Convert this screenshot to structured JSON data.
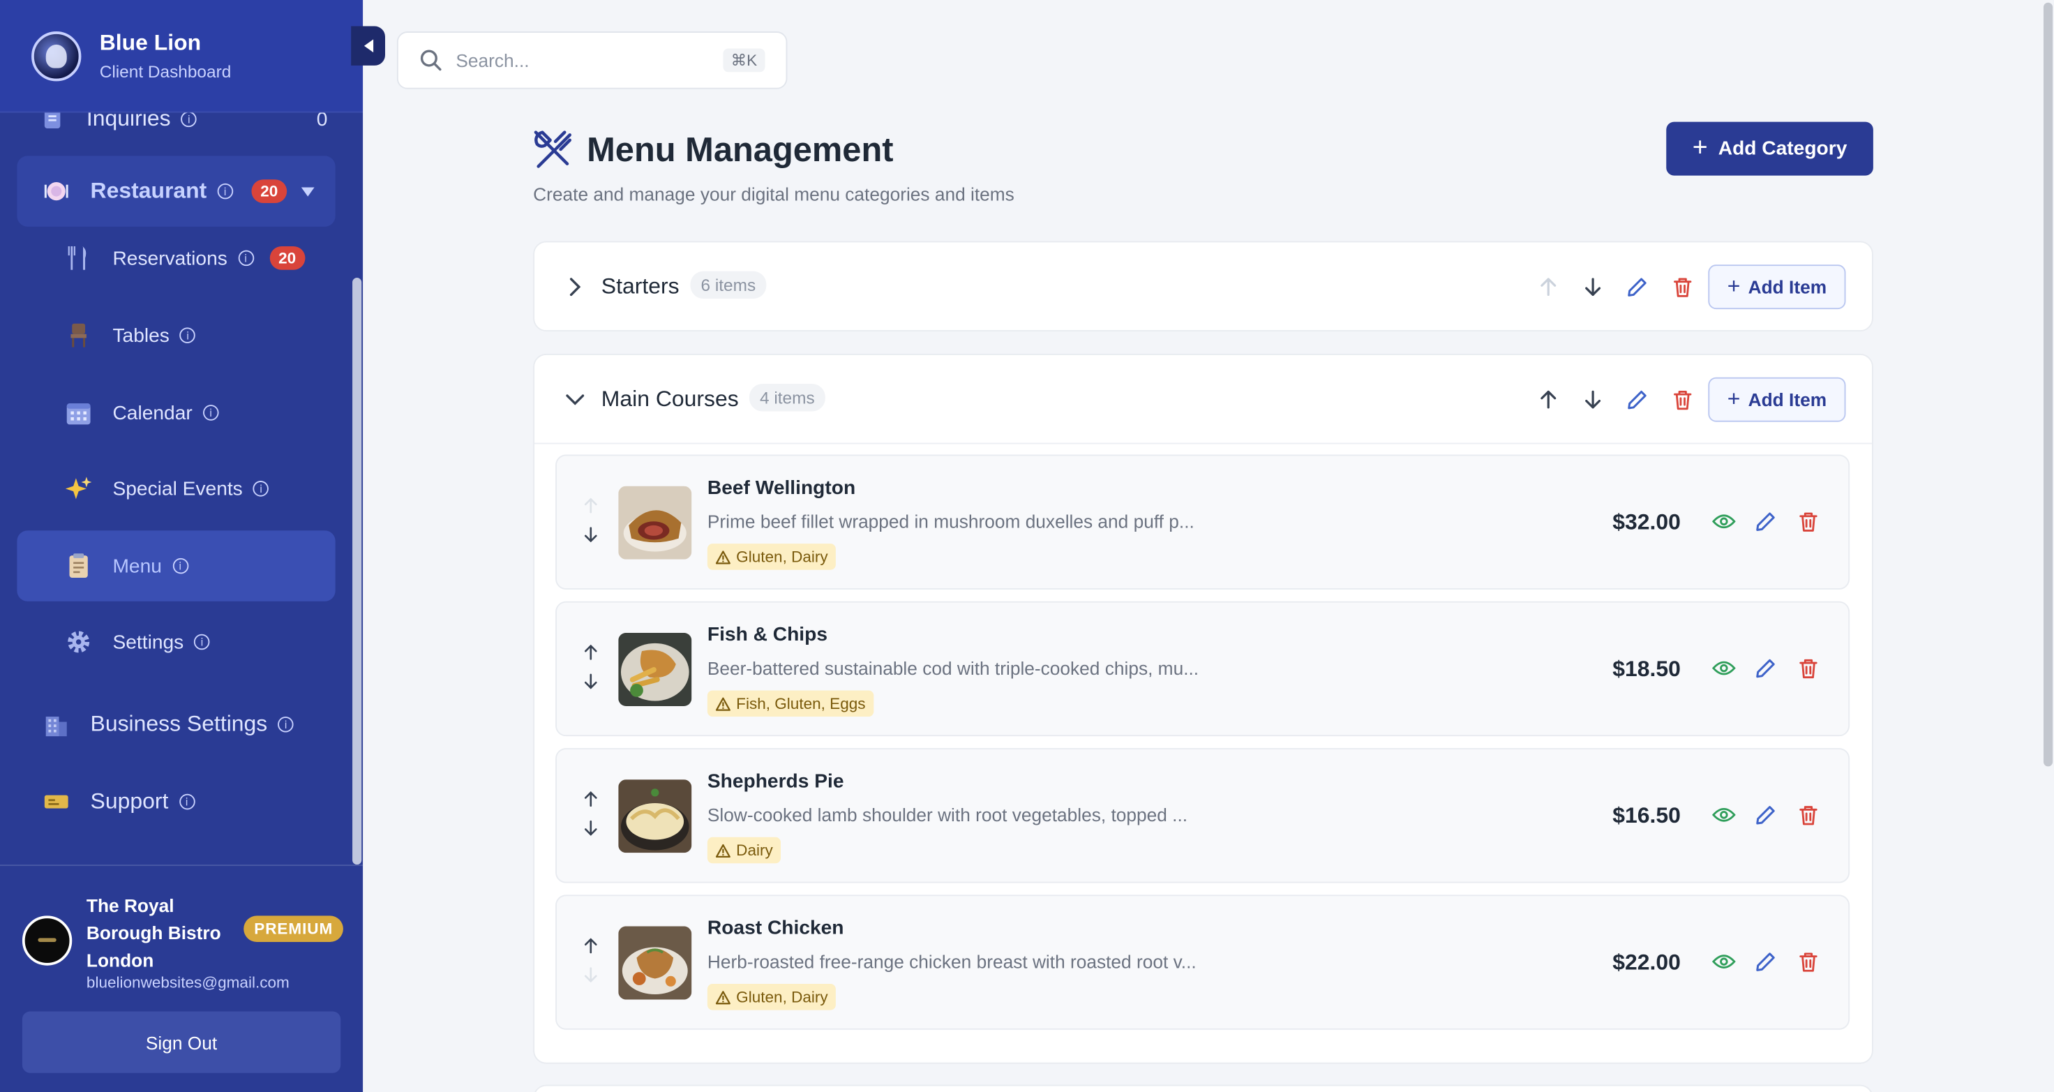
{
  "brand": {
    "title": "Blue Lion",
    "subtitle": "Client Dashboard"
  },
  "search": {
    "placeholder": "Search...",
    "shortcut": "⌘K"
  },
  "sidebar": {
    "items": [
      {
        "label": "Inquiries",
        "count": "0",
        "icon": "inquiries-icon"
      },
      {
        "label": "Restaurant",
        "badge": "20",
        "icon": "restaurant-icon"
      },
      {
        "label": "Reservations",
        "badge": "20",
        "icon": "cutlery-icon"
      },
      {
        "label": "Tables",
        "icon": "chair-icon"
      },
      {
        "label": "Calendar",
        "icon": "calendar-icon"
      },
      {
        "label": "Special Events",
        "icon": "sparkles-icon"
      },
      {
        "label": "Menu",
        "icon": "clipboard-icon"
      },
      {
        "label": "Settings",
        "icon": "gear-icon"
      },
      {
        "label": "Business Settings",
        "icon": "building-icon"
      },
      {
        "label": "Support",
        "icon": "ticket-icon"
      }
    ]
  },
  "profile": {
    "name": "The Royal Borough Bistro London",
    "plan": "PREMIUM",
    "email": "bluelionwebsites@gmail.com",
    "signout_label": "Sign Out"
  },
  "page": {
    "title": "Menu Management",
    "subtitle": "Create and manage your digital menu categories and items",
    "add_category_label": "Add Category"
  },
  "categories": [
    {
      "name": "Starters",
      "count": "6 items",
      "expanded": false,
      "add_item_label": "Add Item"
    },
    {
      "name": "Main Courses",
      "count": "4 items",
      "expanded": true,
      "add_item_label": "Add Item"
    }
  ],
  "items": [
    {
      "name": "Beef Wellington",
      "description": "Prime beef fillet wrapped in mushroom duxelles and puff p...",
      "allergens": "Gluten, Dairy",
      "price": "$32.00"
    },
    {
      "name": "Fish & Chips",
      "description": "Beer-battered sustainable cod with triple-cooked chips, mu...",
      "allergens": "Fish, Gluten, Eggs",
      "price": "$18.50"
    },
    {
      "name": "Shepherds Pie",
      "description": "Slow-cooked lamb shoulder with root vegetables, topped ...",
      "allergens": "Dairy",
      "price": "$16.50"
    },
    {
      "name": "Roast Chicken",
      "description": "Herb-roasted free-range chicken breast with roasted root v...",
      "allergens": "Gluten, Dairy",
      "price": "$22.00"
    }
  ],
  "colors": {
    "sidebar": "#2a3b94",
    "accent": "#2a3b94",
    "danger": "#d9443a",
    "success": "#2f9e5a",
    "premium": "#d7a83c"
  }
}
